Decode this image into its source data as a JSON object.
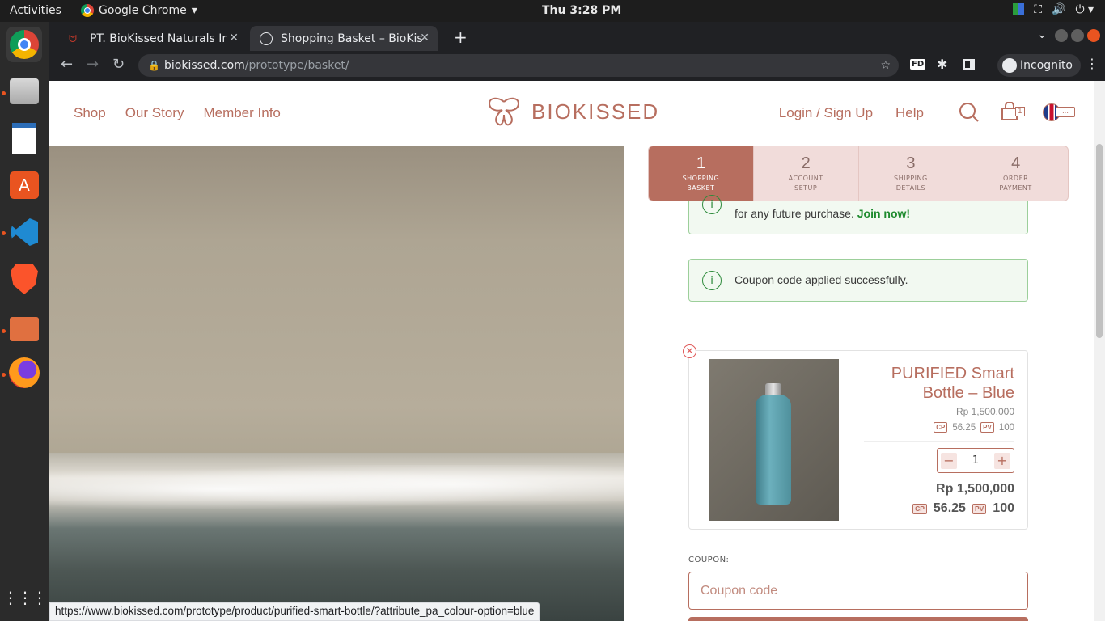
{
  "system": {
    "activities": "Activities",
    "app_name": "Google Chrome",
    "clock": "Thu  3:28 PM"
  },
  "browser": {
    "tabs": [
      {
        "title": "PT. BioKissed Naturals Inc"
      },
      {
        "title": "Shopping Basket – BioKiss"
      }
    ],
    "url_host": "biokissed.com",
    "url_path": "/prototype/basket/",
    "incognito_label": "Incognito",
    "fd_label": "FD",
    "status_url": "https://www.biokissed.com/prototype/product/purified-smart-bottle/?attribute_pa_colour-option=blue"
  },
  "header": {
    "nav_left": [
      "Shop",
      "Our Story",
      "Member Info"
    ],
    "logo_text": "BIOKISSED",
    "nav_right": [
      "Login / Sign Up",
      "Help"
    ],
    "cart_count": "1"
  },
  "steps": [
    {
      "num": "1",
      "label_line1": "SHOPPING",
      "label_line2": "BASKET"
    },
    {
      "num": "2",
      "label_line1": "ACCOUNT",
      "label_line2": "SETUP"
    },
    {
      "num": "3",
      "label_line1": "SHIPPING",
      "label_line2": "DETAILS"
    },
    {
      "num": "4",
      "label_line1": "ORDER",
      "label_line2": "PAYMENT"
    }
  ],
  "alerts": {
    "membership_text": "for any future purchase.",
    "membership_link": "Join now!",
    "coupon_success": "Coupon code applied successfully."
  },
  "cart_item": {
    "name": "PURIFIED Smart Bottle – Blue",
    "unit_price": "Rp 1,500,000",
    "cp_label": "CP",
    "pv_label": "PV",
    "unit_cp": "56.25",
    "unit_pv": "100",
    "quantity": "1",
    "total_price": "Rp 1,500,000",
    "total_cp": "56.25",
    "total_pv": "100"
  },
  "coupon": {
    "label": "COUPON:",
    "placeholder": "Coupon code"
  },
  "colors": {
    "brand": "#b76e5f",
    "success": "#2e8b3c"
  }
}
